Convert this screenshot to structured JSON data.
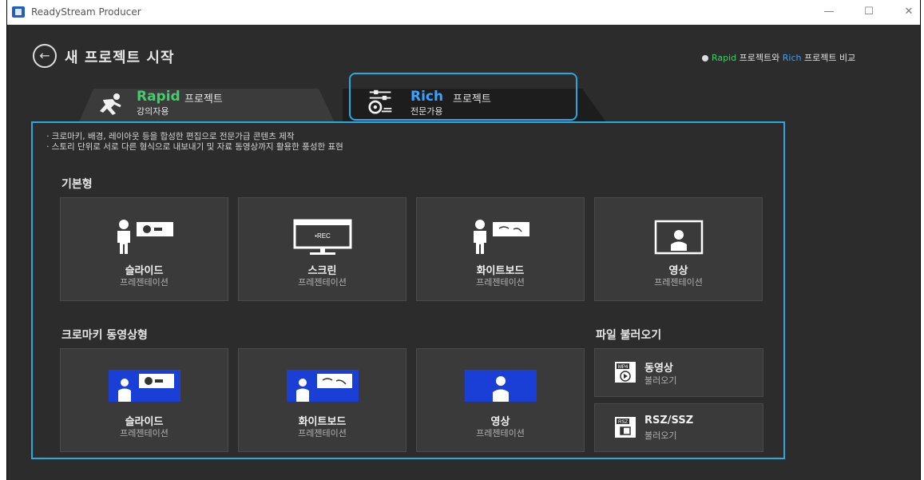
{
  "window": {
    "title": "ReadyStream Producer",
    "minimize": "—",
    "maximize": "☐",
    "close": "✕"
  },
  "header": {
    "back_icon": "arrow-left-circle-icon",
    "title": "새 프로젝트 시작",
    "compare_prefix_dot": "info-icon",
    "compare_rapid": "Rapid",
    "compare_mid": " 프로젝트와 ",
    "compare_rich": "Rich",
    "compare_suffix": " 프로젝트 비교"
  },
  "tabs": {
    "rapid": {
      "name": "Rapid",
      "suffix": "프로젝트",
      "sub": "강의자용",
      "color": "#3fd067",
      "icon": "runner-icon"
    },
    "rich": {
      "name": "Rich",
      "suffix": "프로젝트",
      "sub": "전문가용",
      "color": "#3aa2ff",
      "icon": "sliders-film-icon"
    }
  },
  "description": [
    "ㆍ크로마키, 배경, 레이아웃 등을 합성한 편집으로 전문가급 콘텐츠 제작",
    "ㆍ스토리 단위로 서로 다른 형식으로 내보내기 및 자료 동영상까지 활용한 풍성한 표현"
  ],
  "basic": {
    "title": "기본형",
    "cards": [
      {
        "name": "슬라이드",
        "sub": "프레젠테이션",
        "icon": "presenter-slide-icon"
      },
      {
        "name": "스크린",
        "sub": "프레젠테이션",
        "icon": "monitor-rec-icon",
        "screen_text": "•REC"
      },
      {
        "name": "화이트보드",
        "sub": "프레젠테이션",
        "icon": "presenter-whiteboard-icon"
      },
      {
        "name": "영상",
        "sub": "프레젠테이션",
        "icon": "person-frame-icon"
      }
    ]
  },
  "chroma": {
    "title": "크로마키 동영상형",
    "accent": "#1a3fd6",
    "cards": [
      {
        "name": "슬라이드",
        "sub": "프레젠테이션",
        "icon": "chroma-slide-icon"
      },
      {
        "name": "화이트보드",
        "sub": "프레젠테이션",
        "icon": "chroma-whiteboard-icon"
      },
      {
        "name": "영상",
        "sub": "프레젠테이션",
        "icon": "chroma-person-icon"
      }
    ]
  },
  "import": {
    "title": "파일 불러오기",
    "items": [
      {
        "name": "동영상",
        "sub": "불러오기",
        "icon": "mp4-file-icon",
        "badge": "MP4"
      },
      {
        "name": "RSZ/SSZ",
        "sub": "불러오기",
        "icon": "rsz-file-icon",
        "badge": "RSZ"
      }
    ]
  },
  "colors": {
    "background": "#2c2c2c",
    "card": "#3a3a3a",
    "highlight": "#29a9e0"
  }
}
